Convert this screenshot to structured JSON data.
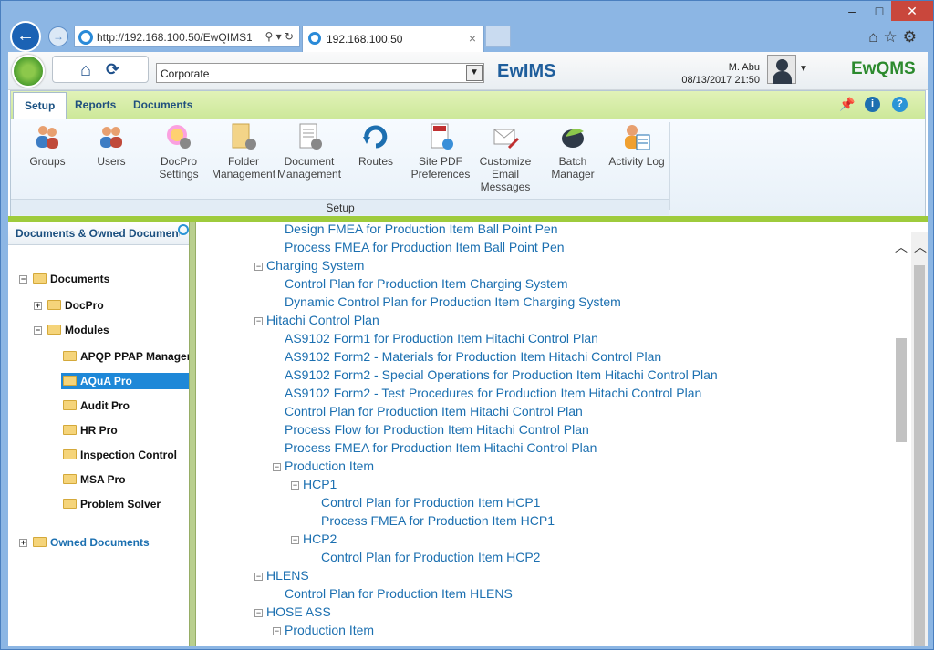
{
  "browser": {
    "url": "http://192.168.100.50/EwQIMS1,",
    "tab_title": "192.168.100.50",
    "minimize": "–",
    "maximize": "□",
    "close": "✕"
  },
  "header": {
    "company": "Corporate",
    "user_name": "M. Abu",
    "datetime": "08/13/2017 21:50",
    "brand_left": "EwIMS",
    "brand_right": "EwQMS"
  },
  "ribbon": {
    "tabs": [
      "Setup",
      "Reports",
      "Documents"
    ],
    "group_label": "Setup",
    "buttons": [
      {
        "label1": "Groups",
        "label2": "",
        "label3": ""
      },
      {
        "label1": "Users",
        "label2": "",
        "label3": ""
      },
      {
        "label1": "DocPro",
        "label2": "Settings",
        "label3": ""
      },
      {
        "label1": "Folder",
        "label2": "Management",
        "label3": ""
      },
      {
        "label1": "Document",
        "label2": "Management",
        "label3": ""
      },
      {
        "label1": "Routes",
        "label2": "",
        "label3": ""
      },
      {
        "label1": "Site PDF",
        "label2": "Preferences",
        "label3": ""
      },
      {
        "label1": "Customize",
        "label2": "Email",
        "label3": "Messages"
      },
      {
        "label1": "Batch",
        "label2": "Manager",
        "label3": ""
      },
      {
        "label1": "Activity Log",
        "label2": "",
        "label3": ""
      }
    ]
  },
  "left_panel": {
    "title": "Documents & Owned Documents",
    "tree": [
      {
        "label": "Documents",
        "pm": "−"
      },
      {
        "label": "DocPro",
        "pm": "+"
      },
      {
        "label": "Modules",
        "pm": "−"
      },
      {
        "label": "APQP PPAP Manager",
        "pm": ""
      },
      {
        "label": "AQuA Pro",
        "pm": ""
      },
      {
        "label": "Audit Pro",
        "pm": ""
      },
      {
        "label": "HR Pro",
        "pm": ""
      },
      {
        "label": "Inspection Control",
        "pm": ""
      },
      {
        "label": "MSA Pro",
        "pm": ""
      },
      {
        "label": "Problem Solver",
        "pm": ""
      },
      {
        "label": "Owned Documents",
        "pm": "+"
      }
    ]
  },
  "content": {
    "items": [
      {
        "label": "Design FMEA for Production Item Ball Point Pen",
        "pm": ""
      },
      {
        "label": "Process FMEA for Production Item Ball Point Pen",
        "pm": ""
      },
      {
        "label": "Charging System",
        "pm": "−"
      },
      {
        "label": "Control Plan for Production Item Charging System",
        "pm": ""
      },
      {
        "label": "Dynamic Control Plan for Production Item Charging System",
        "pm": ""
      },
      {
        "label": "Hitachi Control Plan",
        "pm": "−"
      },
      {
        "label": "AS9102 Form1 for Production Item Hitachi Control Plan",
        "pm": ""
      },
      {
        "label": "AS9102 Form2 - Materials for Production Item Hitachi Control Plan",
        "pm": ""
      },
      {
        "label": "AS9102 Form2 - Special Operations for Production Item Hitachi Control Plan",
        "pm": ""
      },
      {
        "label": "AS9102 Form2 - Test Procedures for Production Item Hitachi Control Plan",
        "pm": ""
      },
      {
        "label": "Control Plan for Production Item Hitachi Control Plan",
        "pm": ""
      },
      {
        "label": "Process Flow for Production Item Hitachi Control Plan",
        "pm": ""
      },
      {
        "label": "Process FMEA for Production Item Hitachi Control Plan",
        "pm": ""
      },
      {
        "label": "Production Item",
        "pm": "−"
      },
      {
        "label": "HCP1",
        "pm": "−"
      },
      {
        "label": "Control Plan for Production Item HCP1",
        "pm": ""
      },
      {
        "label": "Process FMEA for Production Item HCP1",
        "pm": ""
      },
      {
        "label": "HCP2",
        "pm": "−"
      },
      {
        "label": "Control Plan for Production Item HCP2",
        "pm": ""
      },
      {
        "label": "HLENS",
        "pm": "−"
      },
      {
        "label": "Control Plan for Production Item HLENS",
        "pm": ""
      },
      {
        "label": "HOSE ASS",
        "pm": "−"
      },
      {
        "label": "Production Item",
        "pm": "−"
      }
    ]
  }
}
